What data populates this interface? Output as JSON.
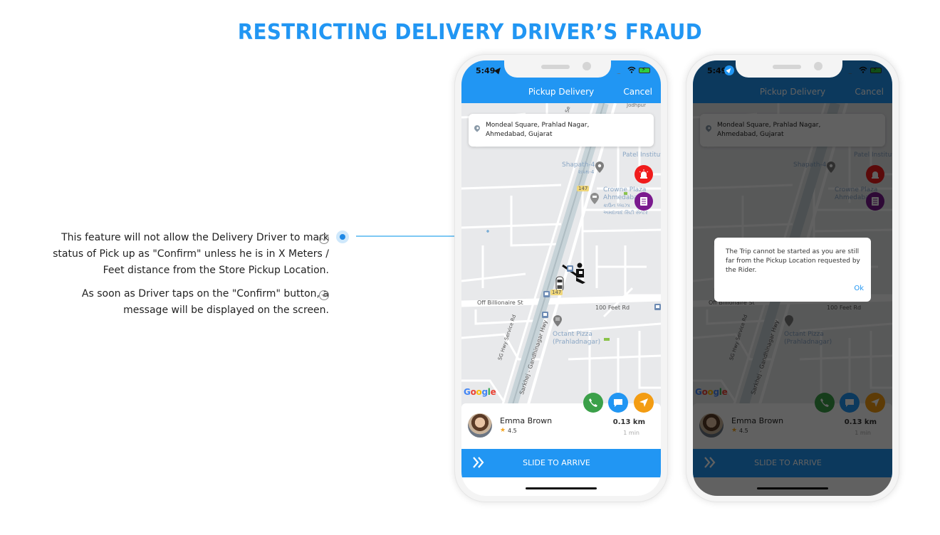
{
  "page": {
    "title": "RESTRICTING DELIVERY DRIVER’S FRAUD",
    "accent_color": "#2196f3"
  },
  "descriptions": [
    {
      "lines": [
        "This feature will not allow the Delivery Driver to mark",
        "status of Pick up as \"Confirm\" unless he is in X Meters /",
        "Feet distance from the Store Pickup Location."
      ]
    },
    {
      "lines": [
        "As soon as Driver taps on the \"Confirm\" button, a",
        "message will be displayed on the screen."
      ]
    }
  ],
  "phones": [
    {
      "status": {
        "time": "5:49",
        "location_icon": "location-arrow-icon",
        "wifi_icon": "wifi-icon",
        "battery_icon": "battery-charging-icon"
      },
      "nav": {
        "title": "Pickup Delivery",
        "cancel_label": "Cancel"
      },
      "address": {
        "line1": "Mondeal Square, Prahlad Nagar,",
        "line2": "Ahmedabad, Gujarat"
      },
      "map": {
        "labels": {
          "street_1": "Off Billionaire St",
          "street_2": "100 Feet Rd",
          "highway_1": "SG Hwy Service Rd",
          "highway_2": "Sarkhej - Gandhinagar Hwy",
          "route_badge": "147",
          "poi_1": "Shapath-4",
          "poi_1_local": "શપથ-4",
          "poi_2": "Crowne Plaza",
          "poi_2b": "Ahmedabad Ci",
          "poi_2_local": "ક્રાઉન પ્લાઝા",
          "poi_2_local_b": "અમદાવાદ સિટી સેન્ટર",
          "poi_3": "Octant Pizza",
          "poi_3b": "(Prahladnagar)",
          "poi_4": "Patel Institute",
          "poi_5": "Jodhpur",
          "google": "Google"
        }
      },
      "fabs": {
        "sos": "siren-icon",
        "list": "clipboard-icon"
      },
      "actions": {
        "call": "phone-icon",
        "chat": "chat-icon",
        "navigate": "navigation-icon"
      },
      "rider": {
        "name": "Emma Brown",
        "rating": "4.5",
        "distance": "0.13 km",
        "eta": "1 min"
      },
      "slide": {
        "label": "SLIDE TO ARRIVE"
      }
    },
    {
      "status": {
        "time": "5:49"
      },
      "nav": {
        "title": "Pickup Delivery",
        "cancel_label": "Cancel"
      },
      "address": {
        "line1": "Mondeal Square, Prahlad Nagar,",
        "line2": "Ahmedabad, Gujarat"
      },
      "rider": {
        "name": "Emma Brown",
        "rating": "4.5",
        "distance": "0.13 km",
        "eta": "1 min"
      },
      "slide": {
        "label": "SLIDE TO ARRIVE"
      },
      "dialog": {
        "message": "The Trip cannot be started as you are still far from the Pickup Location requested by the Rider.",
        "ok_label": "Ok"
      }
    }
  ]
}
